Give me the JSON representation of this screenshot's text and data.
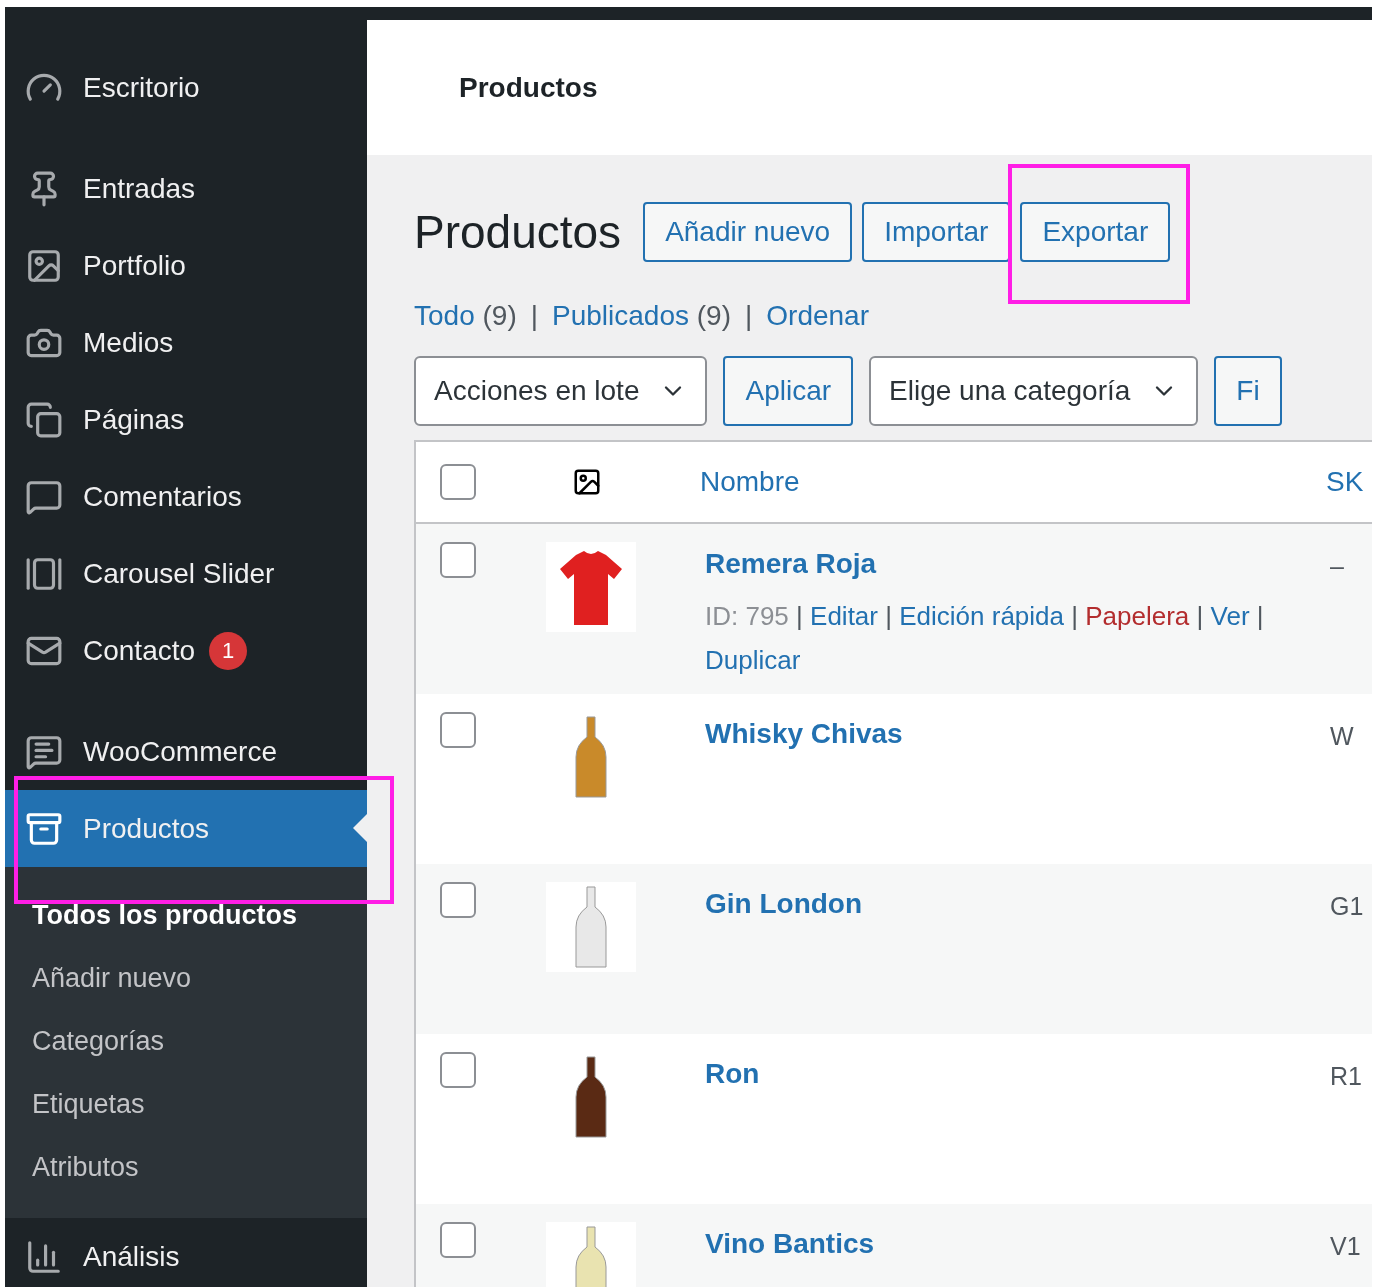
{
  "sidebar": {
    "groups": [
      [
        {
          "label": "Escritorio",
          "selected": false
        }
      ],
      [
        {
          "label": "Entradas",
          "selected": false
        },
        {
          "label": "Portfolio",
          "selected": false
        },
        {
          "label": "Medios",
          "selected": false
        },
        {
          "label": "Páginas",
          "selected": false
        },
        {
          "label": "Comentarios",
          "selected": false
        },
        {
          "label": "Carousel Slider",
          "selected": false
        },
        {
          "label": "Contacto",
          "selected": false,
          "badge": "1"
        }
      ],
      [
        {
          "label": "WooCommerce",
          "selected": false
        },
        {
          "label": "Productos",
          "selected": true,
          "children": [
            {
              "label": "Todos los productos",
              "selected": true
            },
            {
              "label": "Añadir nuevo",
              "selected": false
            },
            {
              "label": "Categorías",
              "selected": false
            },
            {
              "label": "Etiquetas",
              "selected": false
            },
            {
              "label": "Atributos",
              "selected": false
            }
          ]
        },
        {
          "label": "Análisis",
          "selected": false
        }
      ]
    ]
  },
  "header": {
    "title": "Productos"
  },
  "page": {
    "title": "Productos",
    "buttons": [
      {
        "label": "Añadir nuevo",
        "highlighted": false
      },
      {
        "label": "Importar",
        "highlighted": false
      },
      {
        "label": "Exportar",
        "highlighted": true
      }
    ],
    "separator": "|",
    "views": [
      {
        "label": "Todo",
        "count": "(9)"
      },
      {
        "label": "Publicados",
        "count": "(9)"
      },
      {
        "label": "Ordenar"
      }
    ],
    "filters": [
      {
        "kind": "select",
        "label": "Acciones en lote"
      },
      {
        "kind": "button",
        "label": "Aplicar"
      },
      {
        "kind": "select",
        "label": "Elige una categoría"
      },
      {
        "kind": "button",
        "label": "Fi"
      }
    ]
  },
  "menu_highlight": true,
  "table": {
    "action_separator": "|",
    "header_checked": false,
    "columns": [
      "Nombre",
      "SK"
    ],
    "rows": [
      {
        "checked": false,
        "thumb": {
          "kind": "shirt",
          "color": "#e02020"
        },
        "name": "Remera Roja",
        "id": "ID: 795",
        "actions": [
          {
            "label": "Editar",
            "kind": "link"
          },
          {
            "label": "Edición rápida",
            "kind": "link"
          },
          {
            "label": "Papelera",
            "kind": "danger"
          },
          {
            "label": "Ver",
            "kind": "link"
          },
          {
            "label": "Duplicar",
            "kind": "link"
          }
        ],
        "sku": "–"
      },
      {
        "checked": false,
        "thumb": {
          "kind": "bottle",
          "color": "#c98a2a"
        },
        "name": "Whisky Chivas",
        "sku": "W"
      },
      {
        "checked": false,
        "thumb": {
          "kind": "bottle",
          "color": "#e8e8e8"
        },
        "name": "Gin London",
        "sku": "G1"
      },
      {
        "checked": false,
        "thumb": {
          "kind": "bottle",
          "color": "#5a2a14"
        },
        "name": "Ron",
        "sku": "R1"
      },
      {
        "checked": false,
        "thumb": {
          "kind": "bottle",
          "color": "#e9e3b0"
        },
        "name": "Vino Bantics",
        "sku": "V1"
      }
    ]
  }
}
